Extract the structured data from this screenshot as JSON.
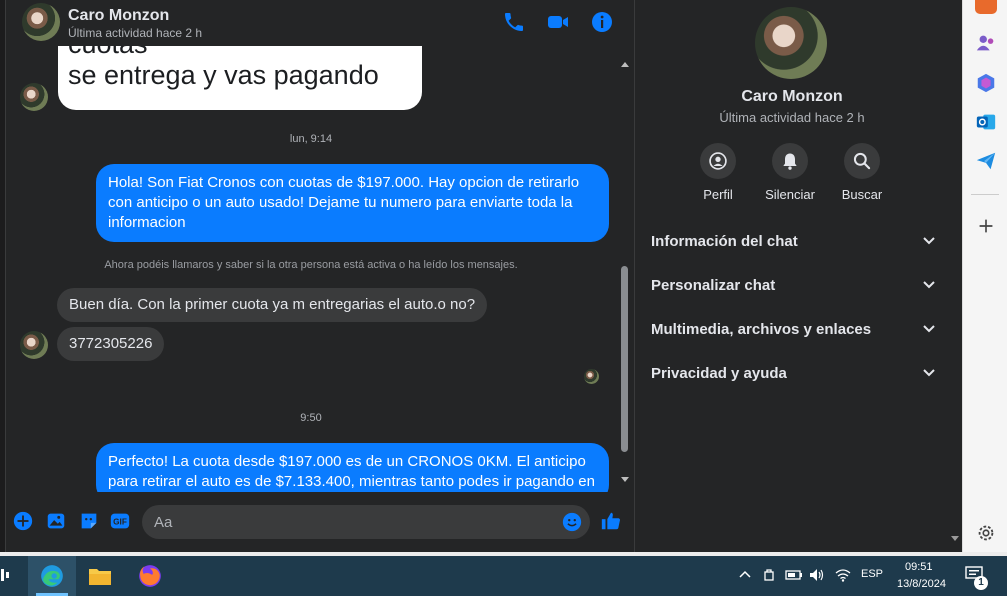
{
  "contact": {
    "name": "Caro Monzon",
    "status": "Última actividad hace 2 h"
  },
  "messages": {
    "partial_received": [
      "cuotas",
      "se entrega y vas pagando"
    ],
    "timestamp_1": "lun, 9:14",
    "sent_1": "Hola! Son Fiat Cronos con cuotas de $197.000. Hay opcion de retirarlo con anticipo o un auto usado! Dejame tu numero para enviarte toda la informacion",
    "notice": "Ahora podéis llamaros y saber si la otra persona está activa o ha leído los mensajes.",
    "received_1": "Buen día. Con la primer cuota ya m entregarias el auto.o no?",
    "received_2": "3772305226",
    "timestamp_2": "9:50",
    "sent_2": "Perfecto! La cuota desde $197.000 es de un CRONOS 0KM. El anticipo para retirar el auto es de $7.133.400, mientras tanto podes ir pagando en"
  },
  "composer": {
    "placeholder": "Aa"
  },
  "info_panel": {
    "actions": [
      {
        "label": "Perfil",
        "icon": "profile-icon"
      },
      {
        "label": "Silenciar",
        "icon": "bell-icon"
      },
      {
        "label": "Buscar",
        "icon": "search-icon"
      }
    ],
    "sections": [
      "Información del chat",
      "Personalizar chat",
      "Multimedia, archivos y enlaces",
      "Privacidad y ayuda"
    ]
  },
  "taskbar": {
    "language": "ESP",
    "time": "09:51",
    "date": "13/8/2024",
    "notification_count": "1"
  },
  "colors": {
    "accent": "#0a7cff",
    "background": "#242526",
    "bubble_in": "#3a3b3c"
  }
}
